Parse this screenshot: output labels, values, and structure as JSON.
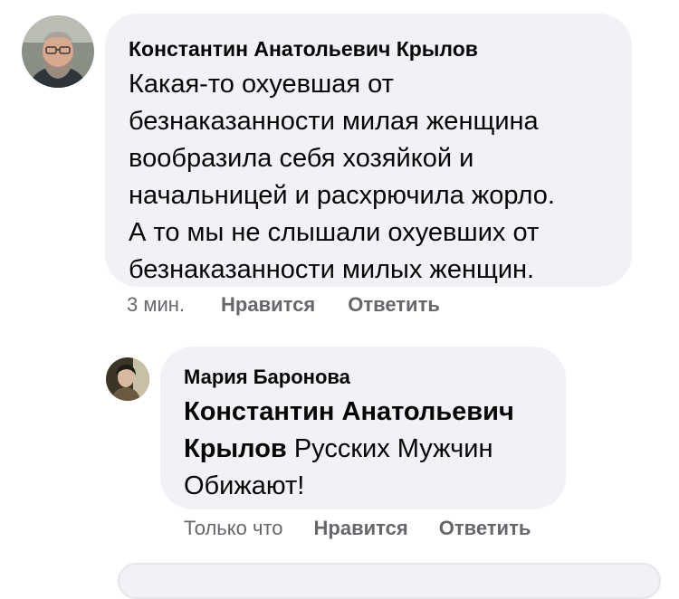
{
  "comments": [
    {
      "author": "Константин Анатольевич Крылов",
      "lines": [
        "Какая-то охуевшая от",
        "безнаказанности милая женщина",
        "вообразила себя хозяйкой и",
        "начальницей и расхрючила жорло.",
        "А то мы не слышали охуевших от",
        "безнаказанности милых женщин."
      ],
      "time": "3 мин.",
      "like_label": "Нравится",
      "reply_label": "Ответить"
    },
    {
      "author": "Мария Баронова",
      "mention_line1": "Константин Анатольевич",
      "mention_line2": "Крылов",
      "text_line2": " Русских Мужчин",
      "text_line3": "Обижают!",
      "time": "Только что",
      "like_label": "Нравится",
      "reply_label": "Ответить"
    }
  ],
  "colors": {
    "bubble": "#f0f2f5",
    "meta_text": "#65676b",
    "text": "#050505"
  },
  "icons": {
    "avatar_1": "avatar-bearded-man-glasses",
    "avatar_2": "avatar-woman-portrait"
  }
}
